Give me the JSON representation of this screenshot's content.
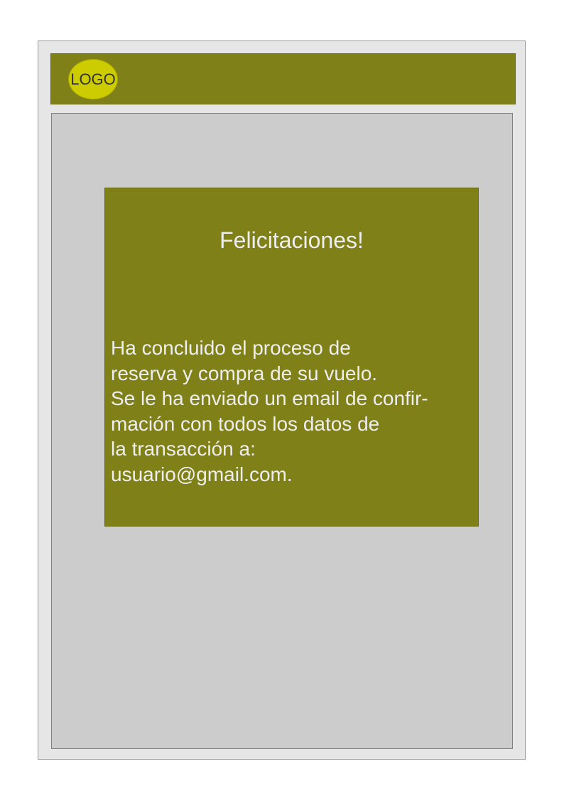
{
  "header": {
    "logo_label": "LOGO"
  },
  "card": {
    "title": "Felicitaciones!",
    "message": "Ha concluido el proceso de\nreserva y compra de su vuelo.\nSe le ha enviado un email de confir-\nmación con todos los datos de\nla transacción a:\nusuario@gmail.com."
  },
  "colors": {
    "header_bg": "#808019",
    "logo_bg": "#cccc00",
    "content_bg": "#cccccc",
    "frame_bg": "#e6e6e6",
    "card_text": "#eeeeee"
  }
}
